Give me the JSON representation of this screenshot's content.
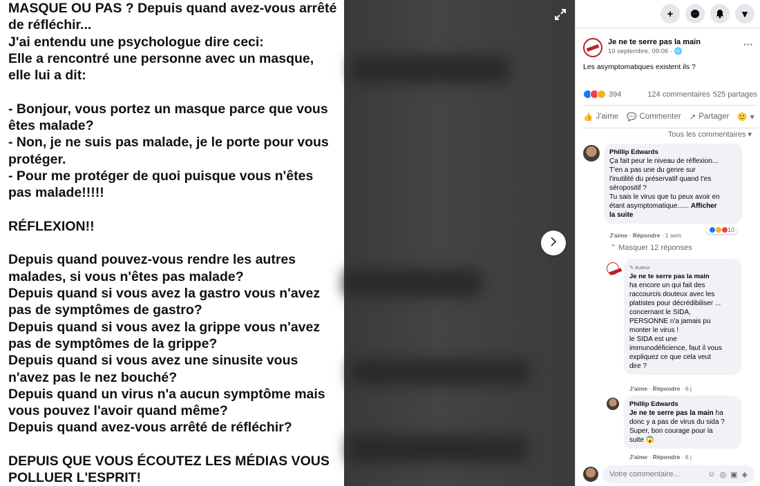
{
  "photo": {
    "lines": [
      "MASQUE OU PAS ? Depuis quand avez-vous arrêté",
      "de réfléchir...",
      "J'ai entendu une psychologue dire ceci:",
      "Elle a rencontré une personne avec un masque,",
      "elle lui a dit:",
      "",
      "- Bonjour, vous portez un masque parce que vous",
      "êtes malade?",
      "- Non, je ne suis pas malade, je le porte pour vous",
      "protéger.",
      "- Pour me protéger de quoi puisque vous n'êtes",
      "pas malade!!!!!",
      "",
      "RÉFLEXION!!",
      "",
      "Depuis quand pouvez-vous rendre les autres",
      "malades, si vous n'êtes pas malade?",
      "Depuis quand si vous avez la gastro vous n'avez",
      "pas de symptômes de gastro?",
      "Depuis quand si vous avez la grippe vous n'avez",
      "pas de symptômes de la grippe?",
      "Depuis quand si vous avez une sinusite vous",
      "n'avez pas le nez bouché?",
      "Depuis quand un virus n'a aucun symptôme mais",
      "vous pouvez l'avoir quand même?",
      "Depuis quand avez-vous arrêté de réfléchir?",
      "",
      "DEPUIS QUE VOUS ÉCOUTEZ LES MÉDIAS VOUS",
      "POLLUER L'ESPRIT!"
    ]
  },
  "icons": {
    "expand": "expand-icon",
    "next": "chevron-right-icon",
    "plus": "+",
    "messenger": "messenger-icon",
    "bell": "bell-icon",
    "caret": "▾"
  },
  "post": {
    "page_name": "Je ne te serre pas la main",
    "date": "10 septembre, 09:06 · ",
    "caption": "Les asymptomatiques existent ils ?",
    "reactions_count": "394",
    "comments_count": "124 commentaires",
    "shares_count": "525 partages",
    "like_label": "J'aime",
    "comment_label": "Commenter",
    "share_label": "Partager",
    "all_comments_label": "Tous les commentaires"
  },
  "comments": [
    {
      "author": "Phillip Edwards",
      "text": "Ça fait peur le niveau de réflexion...\nT'en a pas une du genre sur\nl'inutilité du préservatif quand t'es\nséropositif ?\nTu sais le virus que tu peux avoir en\nétant asymptomatique......",
      "more": "Afficher\nla suite",
      "like": "J'aime",
      "reply": "Répondre",
      "time": "1 sem",
      "reaction_count": "10"
    }
  ],
  "hide_replies": "Masquer 12 réponses",
  "replies": [
    {
      "tag": "Auteur",
      "author": "Je ne te serre pas la main",
      "text": "ha encore un qui fait des\nraccourcis douteux avec les\nplatistes pour décrédibiliser ...\nconcernant le SIDA,\nPERSONNE n'a jamais pu\nmonter le virus !\nle SIDA est une\nimmunodéficience, faut il vous\nexpliquez ce que cela veut\ndire ?",
      "like": "J'aime",
      "reply": "Répondre",
      "time": "6 j"
    },
    {
      "author": "Phillip Edwards",
      "mention": "Je ne te serre pas la main",
      "text": " ha\ndonc y a pas de virus du sida ?\nSuper, bon courage pour la\nsuite ",
      "like": "J'aime",
      "reply": "Répondre",
      "time": "6 j"
    }
  ],
  "composer": {
    "placeholder": "Votre commentaire..."
  },
  "colors": {
    "fb_blue": "#1877f2",
    "love_red": "#f33e58",
    "haha_yellow": "#f7b125"
  }
}
